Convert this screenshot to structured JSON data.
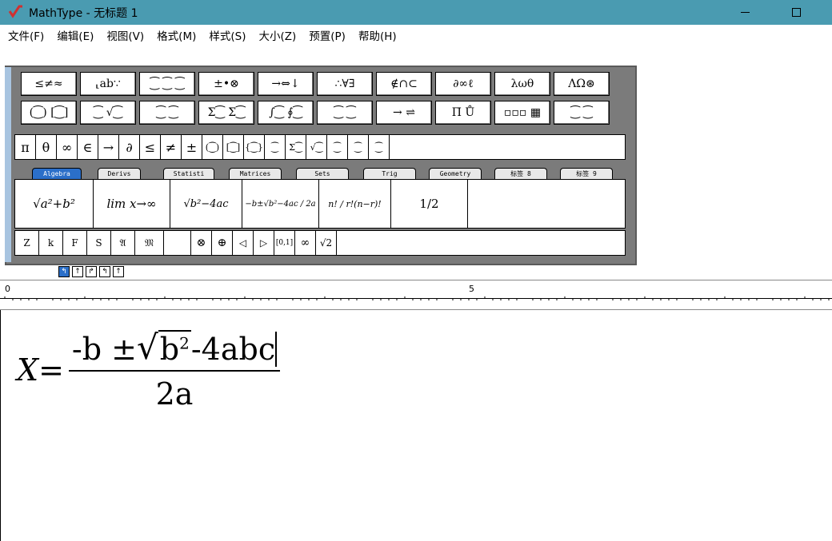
{
  "window": {
    "title": "MathType - 无标题 1",
    "minimize_label": "—",
    "maximize_label": "☐"
  },
  "menu": [
    "文件(F)",
    "编辑(E)",
    "视图(V)",
    "格式(M)",
    "样式(S)",
    "大小(Z)",
    "预置(P)",
    "帮助(H)"
  ],
  "toolbar": {
    "row1": [
      "≤≠≈",
      "⸤ab∵",
      "⁐ ⁐ ⁐",
      "±•⊗",
      "→⇔↓",
      "∴∀∃",
      "∉∩⊂",
      "∂∞ℓ",
      "λωθ",
      "ΛΩ⊛"
    ],
    "row2": [
      "(⁐) [⁐]",
      "⁐ √⁐",
      "⁐ ⁐",
      "Σ⁐ Σ⁐",
      "∫⁐ ∮⁐",
      "⁐ ⁐",
      "→ ⇌",
      "Π̄ Ů",
      "▫▫▫ ▦",
      "⁐ ⁐"
    ],
    "symbols": [
      "π",
      "θ",
      "∞",
      "∈",
      "→",
      "∂",
      "≤",
      "≠",
      "±",
      "(⁐)",
      "[⁐]",
      "{⁐}",
      "⁐",
      "Σ⁐",
      "√⁐",
      "⁐",
      "⁐",
      "⁐"
    ],
    "tabs": [
      "Algebra",
      "Derivs",
      "Statisti",
      "Matrices",
      "Sets",
      "Trig",
      "Geometry",
      "标签 8",
      "标签 9"
    ],
    "templates": [
      "√a²+b²",
      "lim x→∞",
      "√b²−4ac",
      "−b±√b²−4ac / 2a",
      "n! / r!(n−r)!",
      "1/2"
    ],
    "bottom": [
      "Z",
      "k",
      "F",
      "S",
      "𝔄",
      "𝔐",
      "",
      "⊗",
      "⊕",
      "◁",
      "▷",
      "[0,1]",
      "∞",
      "√2"
    ]
  },
  "nudge": [
    "↰",
    "↑",
    "↱",
    "↰",
    "↑"
  ],
  "ruler": {
    "start": "0",
    "mid": "5"
  },
  "equation": {
    "lhs": "X",
    "equals": "=",
    "numerator_pre": "-b ± ",
    "radicand_base": "b",
    "radicand_exp": "2",
    "numerator_post": " -4abc",
    "denominator": "2a"
  }
}
